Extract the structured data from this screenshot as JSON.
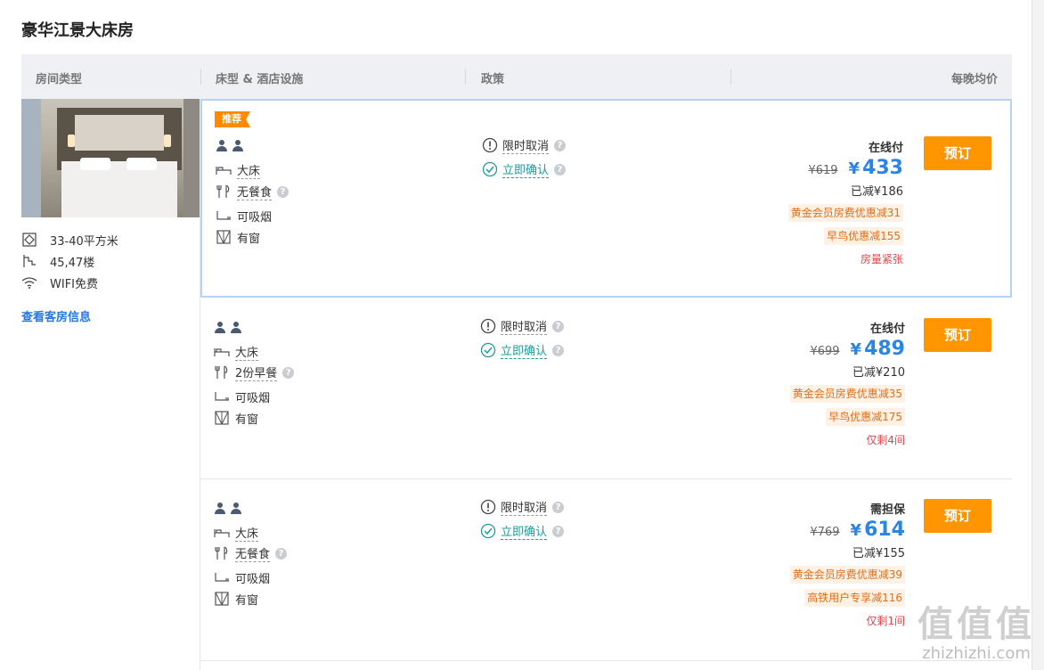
{
  "page": {
    "title": "豪华江景大床房"
  },
  "header": {
    "col_room_type": "房间类型",
    "col_bed": "床型 & 酒店设施",
    "col_policy": "政策",
    "col_price": "每晚均价"
  },
  "room": {
    "features": [
      {
        "icon": "area-icon",
        "text": "33-40平方米"
      },
      {
        "icon": "floor-icon",
        "text": "45,47楼"
      },
      {
        "icon": "wifi-icon",
        "text": "WIFI免费"
      }
    ],
    "info_link": "查看客房信息"
  },
  "offers": [
    {
      "badge": "推荐",
      "bed": "大床",
      "meal": "无餐食",
      "smoking": "可吸烟",
      "window": "有窗",
      "policy_cancel": "限时取消",
      "policy_confirm": "立即确认",
      "pay_type": "在线付",
      "orig_price": "¥619",
      "price_symbol": "¥",
      "price": "433",
      "saved": "已减¥186",
      "promos": [
        "黄金会员房费优惠减31",
        "早鸟优惠减155"
      ],
      "scarcity": "房量紧张",
      "book": "预订"
    },
    {
      "bed": "大床",
      "meal": "2份早餐",
      "smoking": "可吸烟",
      "window": "有窗",
      "policy_cancel": "限时取消",
      "policy_confirm": "立即确认",
      "pay_type": "在线付",
      "orig_price": "¥699",
      "price_symbol": "¥",
      "price": "489",
      "saved": "已减¥210",
      "promos": [
        "黄金会员房费优惠减35",
        "早鸟优惠减175"
      ],
      "scarcity": "仅剩4间",
      "book": "预订"
    },
    {
      "bed": "大床",
      "meal": "无餐食",
      "smoking": "可吸烟",
      "window": "有窗",
      "policy_cancel": "限时取消",
      "policy_confirm": "立即确认",
      "pay_type": "需担保",
      "orig_price": "¥769",
      "price_symbol": "¥",
      "price": "614",
      "saved": "已减¥155",
      "promos": [
        "黄金会员房费优惠减39",
        "高铁用户专享减116"
      ],
      "scarcity": "仅剩1间",
      "book": "预订"
    }
  ],
  "watermark": {
    "big": "值值值",
    "small": "zhizhizhi.com"
  },
  "colors": {
    "accent": "#2b85e4",
    "book_button": "#ff9500",
    "promo": "#e06d1a",
    "scarcity": "#e0454a"
  }
}
